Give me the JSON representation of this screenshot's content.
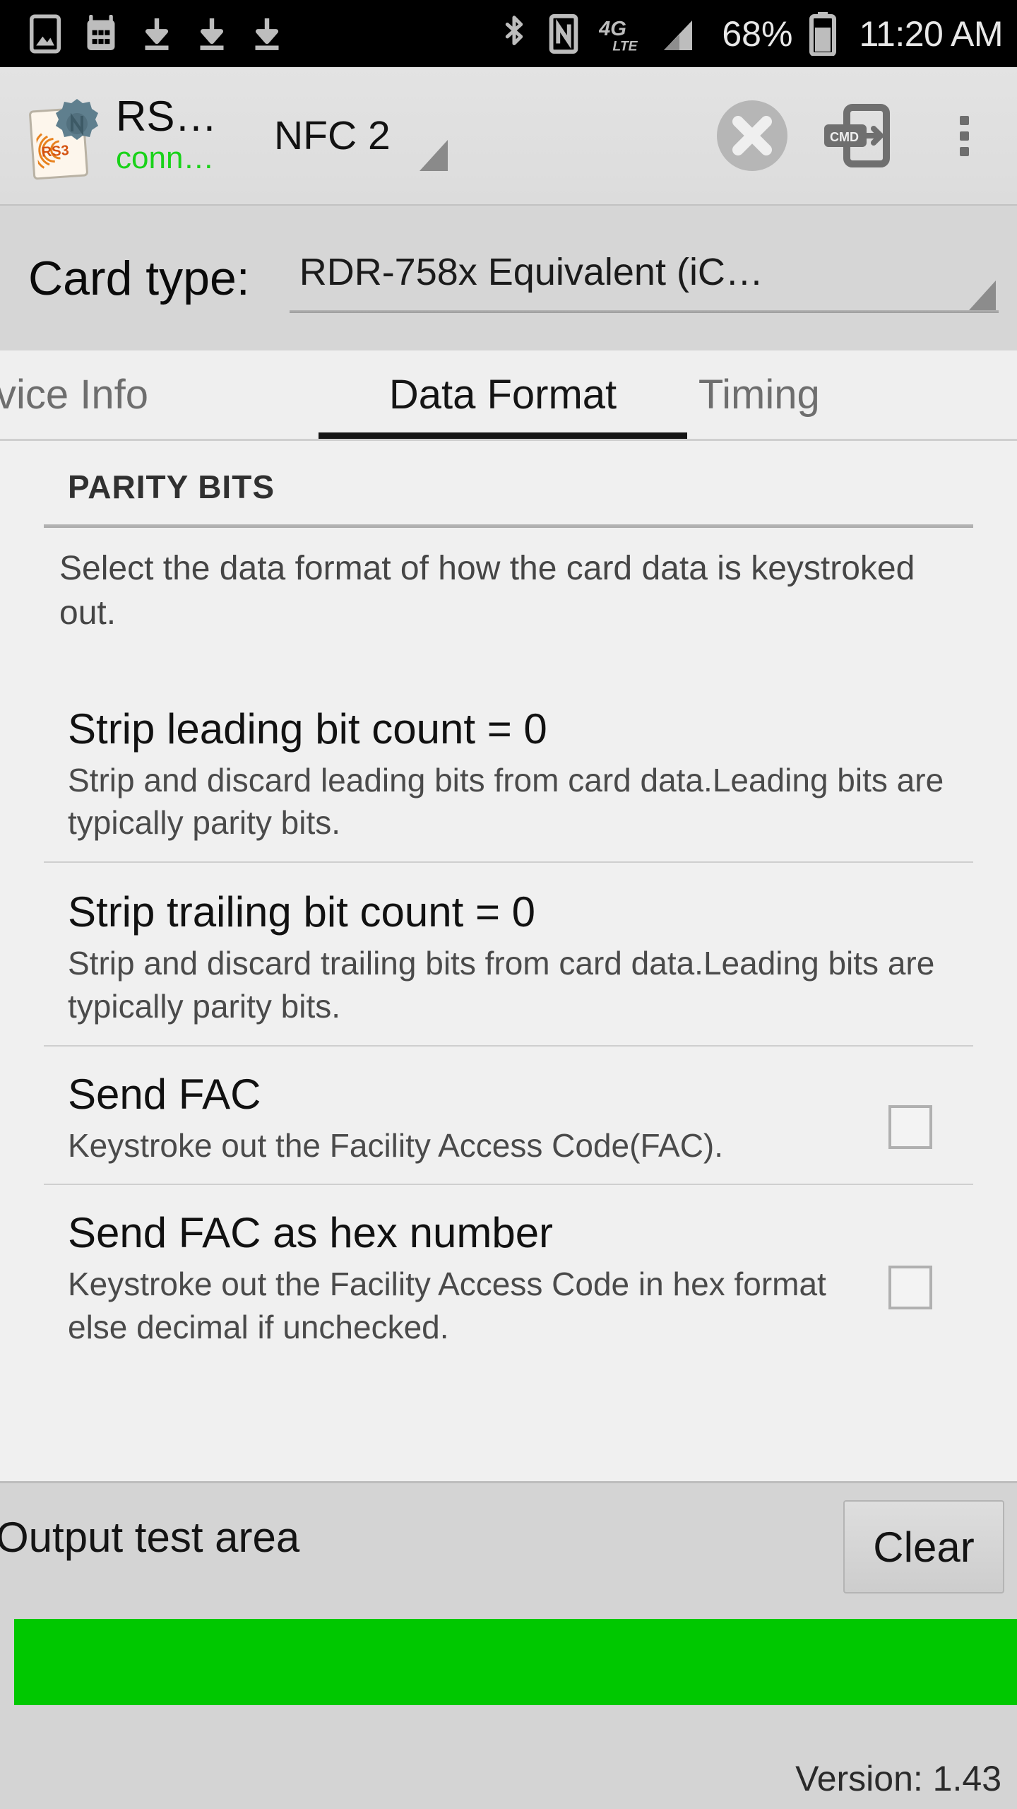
{
  "status_bar": {
    "icons": [
      "image-icon",
      "calendar-icon",
      "download-icon",
      "download-icon",
      "download-icon",
      "bluetooth-icon",
      "nfc-icon",
      "lte-4g-icon",
      "signal-bars-icon"
    ],
    "battery_percent": "68%",
    "battery_icon": "battery-icon",
    "time": "11:20 AM"
  },
  "action_bar": {
    "logo_icon": "rs3-nfc-logo-icon",
    "title": "RS…",
    "subtitle": "conn…",
    "subtitle_color": "#19d219",
    "spinner_value": "NFC 2",
    "spinner_caret_icon": "dropdown-caret-icon",
    "disconnect_icon": "disconnect-x-icon",
    "cmd_icon": "cmd-send-icon",
    "overflow_icon": "overflow-menu-icon"
  },
  "card_type": {
    "label": "Card type:",
    "value": "RDR-758x Equivalent (iC…",
    "caret_icon": "dropdown-caret-icon"
  },
  "tabs": [
    {
      "label": "vice Info",
      "active": false
    },
    {
      "label": "Data Format",
      "active": true
    },
    {
      "label": "Timing",
      "active": false
    }
  ],
  "section": {
    "header": "PARITY BITS",
    "description": "Select the data format of how the card data is keystroked out."
  },
  "rows": [
    {
      "title": "Strip leading bit count = 0",
      "subtitle": "Strip and discard leading bits from card data.Leading bits are typically parity bits.",
      "has_checkbox": false
    },
    {
      "title": "Strip trailing bit count = 0",
      "subtitle": "Strip and discard trailing bits from card data.Leading bits are typically parity bits.",
      "has_checkbox": false
    },
    {
      "title": "Send FAC",
      "subtitle": "Keystroke out the Facility Access Code(FAC).",
      "has_checkbox": true,
      "checked": false
    },
    {
      "title": "Send FAC as hex number",
      "subtitle": "Keystroke out the Facility Access Code in hex format else decimal if unchecked.",
      "has_checkbox": true,
      "checked": false
    }
  ],
  "output_area": {
    "label": "Output test area",
    "clear_label": "Clear",
    "status_bar_color": "#00c800",
    "version": "Version: 1.43"
  }
}
